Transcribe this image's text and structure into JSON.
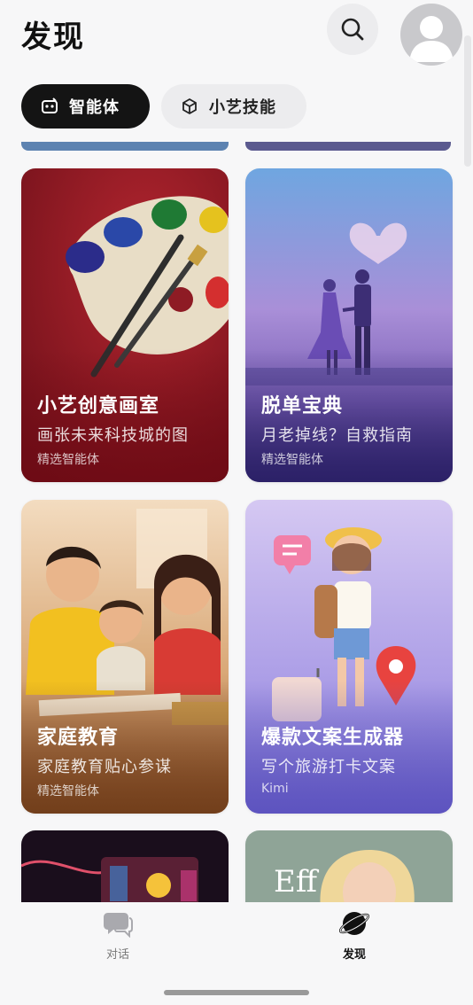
{
  "header": {
    "title": "发现",
    "search_icon": "search-icon",
    "avatar_icon": "user-avatar-icon"
  },
  "tabs": [
    {
      "label": "智能体",
      "icon": "agent-icon",
      "active": true
    },
    {
      "label": "小艺技能",
      "icon": "skill-cube-icon",
      "active": false
    }
  ],
  "cards": [
    {
      "title": "小艺创意画室",
      "subtitle": "画张未来科技城的图",
      "tag": "精选智能体",
      "image": "paint-palette-illustration"
    },
    {
      "title": "脱单宝典",
      "subtitle": "月老掉线？自救指南",
      "tag": "精选智能体",
      "image": "couple-silhouette-illustration"
    },
    {
      "title": "家庭教育",
      "subtitle": "家庭教育贴心参谋",
      "tag": "精选智能体",
      "image": "family-study-illustration"
    },
    {
      "title": "爆款文案生成器",
      "subtitle": "写个旅游打卡文案",
      "tag": "Kimi",
      "image": "traveler-girl-illustration"
    },
    {
      "image": "neon-arcade-illustration"
    },
    {
      "image": "blonde-portrait-illustration",
      "overlay_text": "Eff"
    }
  ],
  "bottom_nav": [
    {
      "label": "对话",
      "icon": "chat-bubble-icon",
      "active": false
    },
    {
      "label": "发现",
      "icon": "discover-planet-icon",
      "active": true
    }
  ],
  "colors": {
    "accent": "#141414",
    "card1": "#8e1b24",
    "card2": "#5a4e9a",
    "card3": "#a5673c",
    "card4": "#8e86d6"
  }
}
